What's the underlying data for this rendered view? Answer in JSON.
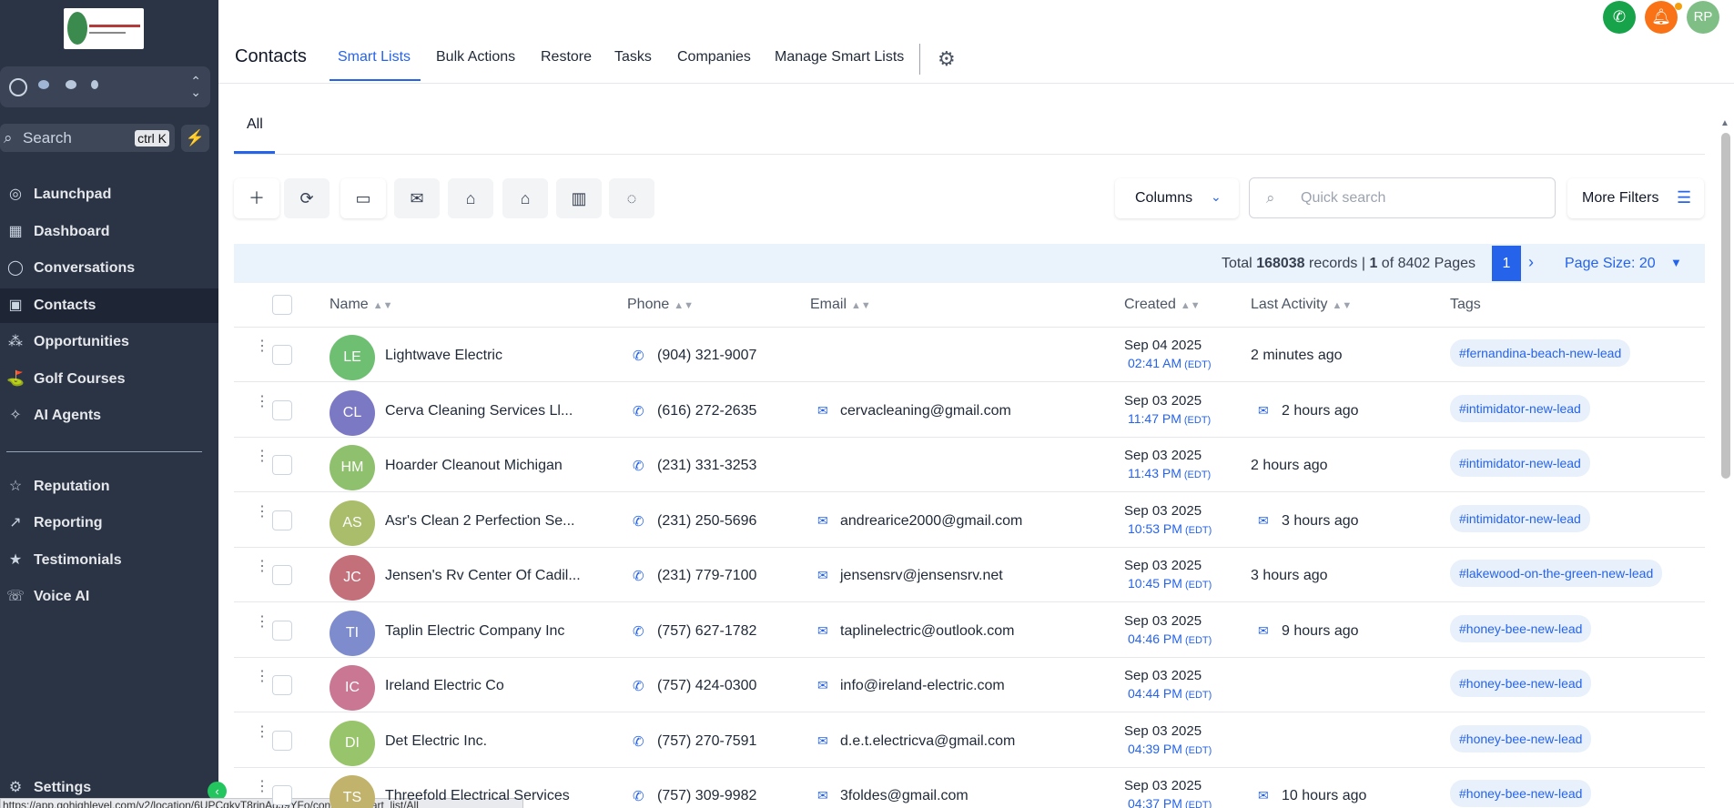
{
  "sidebar": {
    "search_placeholder": "Search",
    "search_shortcut": "ctrl K",
    "nav": [
      {
        "label": "Launchpad",
        "icon": "launchpad-icon"
      },
      {
        "label": "Dashboard",
        "icon": "dashboard-icon"
      },
      {
        "label": "Conversations",
        "icon": "chat-icon"
      },
      {
        "label": "Contacts",
        "icon": "contacts-icon",
        "active": true
      },
      {
        "label": "Opportunities",
        "icon": "opportunities-icon"
      },
      {
        "label": "Golf Courses",
        "icon": "golf-cart-icon"
      },
      {
        "label": "AI Agents",
        "icon": "sparkle-icon"
      },
      {
        "label": "Reputation",
        "icon": "star-icon"
      },
      {
        "label": "Reporting",
        "icon": "trend-icon"
      },
      {
        "label": "Testimonials",
        "icon": "star-badge-icon"
      },
      {
        "label": "Voice AI",
        "icon": "voice-icon"
      },
      {
        "label": "Settings",
        "icon": "gear-icon"
      }
    ]
  },
  "status_url": "https://app.gohighlevel.com/v2/location/6UPCqkyT8rinAqJ9YFo/contacts/smart_list/All",
  "header": {
    "title": "Contacts",
    "tabs": [
      "Smart Lists",
      "Bulk Actions",
      "Restore",
      "Tasks",
      "Companies",
      "Manage Smart Lists"
    ],
    "avatar_initials": "RP"
  },
  "subtab": "All",
  "toolbar": {
    "columns_label": "Columns",
    "search_placeholder": "Quick search",
    "more_filters_label": "More Filters"
  },
  "pagination": {
    "total_prefix": "Total",
    "total_records": "168038",
    "records_word": "records |",
    "current_page": "1",
    "of_pages": "of 8402 Pages",
    "page_size": "Page Size: 20"
  },
  "table": {
    "headers": {
      "name": "Name",
      "phone": "Phone",
      "email": "Email",
      "created": "Created",
      "last_activity": "Last Activity",
      "tags": "Tags"
    },
    "rows": [
      {
        "initials": "LE",
        "avatar_color": "#6fbf73",
        "name": "Lightwave Electric",
        "phone": "(904) 321-9007",
        "email": "",
        "created_date": "Sep 04 2025",
        "created_time": "02:41 AM",
        "tz": "(EDT)",
        "last_activity": "2 minutes ago",
        "activity_icon": false,
        "tag": "#fernandina-beach-new-lead"
      },
      {
        "initials": "CL",
        "avatar_color": "#7b78c4",
        "name": "Cerva Cleaning Services Ll...",
        "phone": "(616) 272-2635",
        "email": "cervacleaning@gmail.com",
        "created_date": "Sep 03 2025",
        "created_time": "11:47 PM",
        "tz": "(EDT)",
        "last_activity": "2 hours ago",
        "activity_icon": true,
        "tag": "#intimidator-new-lead"
      },
      {
        "initials": "HM",
        "avatar_color": "#8fc06e",
        "name": "Hoarder Cleanout Michigan",
        "phone": "(231) 331-3253",
        "email": "",
        "created_date": "Sep 03 2025",
        "created_time": "11:43 PM",
        "tz": "(EDT)",
        "last_activity": "2 hours ago",
        "activity_icon": false,
        "tag": "#intimidator-new-lead"
      },
      {
        "initials": "AS",
        "avatar_color": "#a9bd6a",
        "name": "Asr's Clean 2 Perfection Se...",
        "phone": "(231) 250-5696",
        "email": "andrearice2000@gmail.com",
        "created_date": "Sep 03 2025",
        "created_time": "10:53 PM",
        "tz": "(EDT)",
        "last_activity": "3 hours ago",
        "activity_icon": true,
        "tag": "#intimidator-new-lead"
      },
      {
        "initials": "JC",
        "avatar_color": "#c4707a",
        "name": "Jensen's Rv Center Of Cadil...",
        "phone": "(231) 779-7100",
        "email": "jensensrv@jensensrv.net",
        "created_date": "Sep 03 2025",
        "created_time": "10:45 PM",
        "tz": "(EDT)",
        "last_activity": "3 hours ago",
        "activity_icon": false,
        "tag": "#lakewood-on-the-green-new-lead"
      },
      {
        "initials": "TI",
        "avatar_color": "#7e8ccd",
        "name": "Taplin Electric Company Inc",
        "phone": "(757) 627-1782",
        "email": "taplinelectric@outlook.com",
        "created_date": "Sep 03 2025",
        "created_time": "04:46 PM",
        "tz": "(EDT)",
        "last_activity": "9 hours ago",
        "activity_icon": true,
        "tag": "#honey-bee-new-lead"
      },
      {
        "initials": "IC",
        "avatar_color": "#c97792",
        "name": "Ireland Electric Co",
        "phone": "(757) 424-0300",
        "email": "info@ireland-electric.com",
        "created_date": "Sep 03 2025",
        "created_time": "04:44 PM",
        "tz": "(EDT)",
        "last_activity": "",
        "activity_icon": false,
        "tag": "#honey-bee-new-lead"
      },
      {
        "initials": "DI",
        "avatar_color": "#98c46b",
        "name": "Det Electric Inc.",
        "phone": "(757) 270-7591",
        "email": "d.e.t.electricva@gmail.com",
        "created_date": "Sep 03 2025",
        "created_time": "04:39 PM",
        "tz": "(EDT)",
        "last_activity": "",
        "activity_icon": false,
        "tag": "#honey-bee-new-lead"
      },
      {
        "initials": "TS",
        "avatar_color": "#c2b36c",
        "name": "Threefold Electrical Services",
        "phone": "(757) 309-9982",
        "email": "3foldes@gmail.com",
        "created_date": "Sep 03 2025",
        "created_time": "04:37 PM",
        "tz": "(EDT)",
        "last_activity": "10 hours ago",
        "activity_icon": true,
        "tag": "#honey-bee-new-lead"
      }
    ]
  }
}
